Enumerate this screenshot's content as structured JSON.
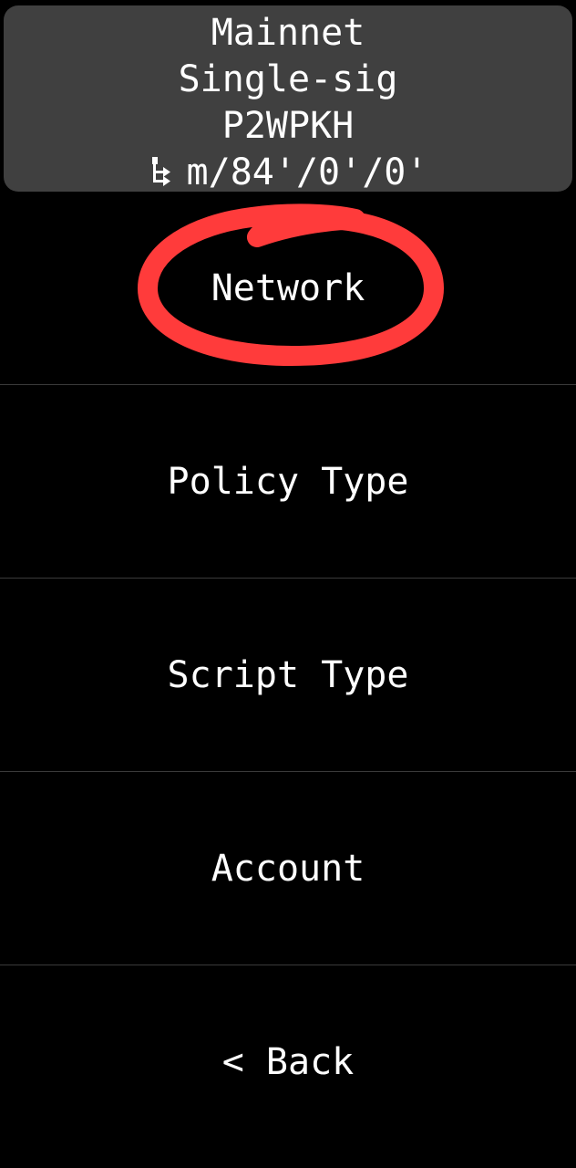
{
  "header": {
    "network": "Mainnet",
    "policy": "Single-sig",
    "script": "P2WPKH",
    "derivation": "m/84'/0'/0'",
    "derivation_icon": "derivation-path-icon"
  },
  "menu": {
    "items": [
      {
        "label": "Network"
      },
      {
        "label": "Policy Type"
      },
      {
        "label": "Script Type"
      },
      {
        "label": "Account"
      },
      {
        "label": "< Back"
      }
    ]
  },
  "annotation": {
    "color": "#ff3b3b",
    "target": "Network"
  }
}
